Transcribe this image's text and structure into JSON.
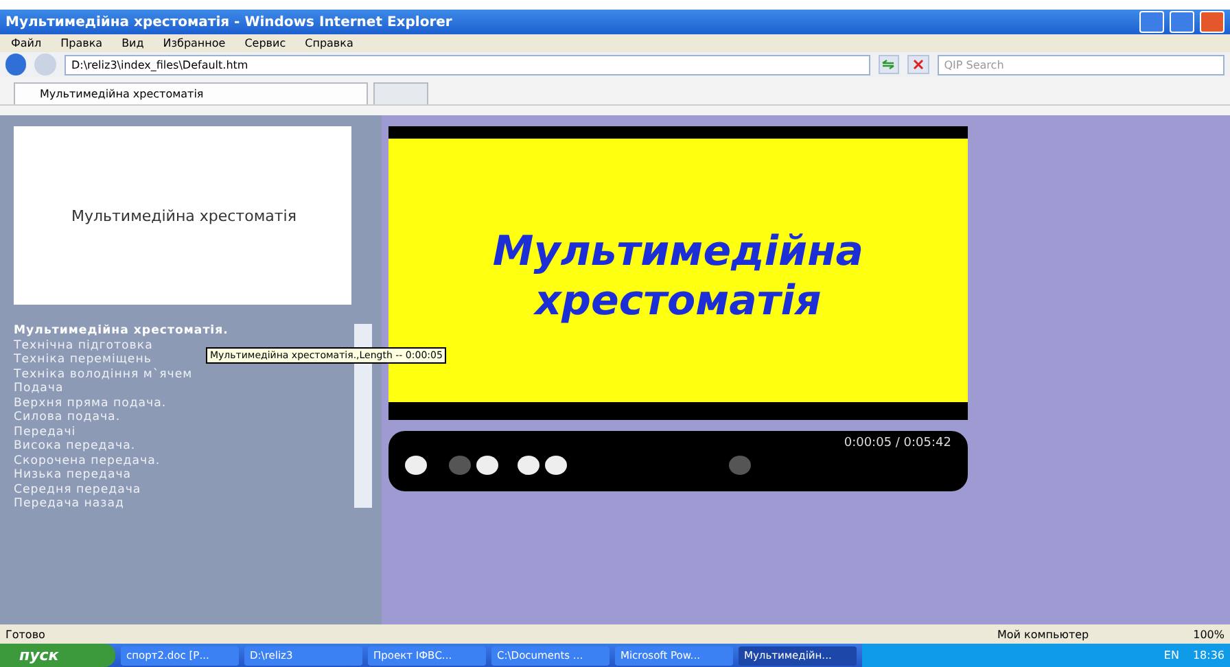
{
  "window": {
    "title": "Мультимедійна хрестоматія - Windows Internet Explorer"
  },
  "menu": [
    "Файл",
    "Правка",
    "Вид",
    "Избранное",
    "Сервис",
    "Справка"
  ],
  "address": {
    "value": "D:\\reliz3\\index_files\\Default.htm"
  },
  "search": {
    "placeholder": "QIP Search"
  },
  "tabs": [
    {
      "label": "Мультимедійна хрестоматія",
      "selected": true
    }
  ],
  "slide_thumbnail": {
    "title": "Мультимедійна хрестоматія"
  },
  "playlist": [
    {
      "label": "Мультимедійна хрестоматія.",
      "selected": true
    },
    {
      "label": "Технічна підготовка",
      "selected": false
    },
    {
      "label": "Техніка переміщень",
      "selected": false
    },
    {
      "label": "Техніка володіння м`ячем",
      "selected": false
    },
    {
      "label": "Подача",
      "selected": false
    },
    {
      "label": "Верхня пряма подача.",
      "selected": false
    },
    {
      "label": "Силова подача.",
      "selected": false
    },
    {
      "label": "Передачі",
      "selected": false
    },
    {
      "label": "Висока передача.",
      "selected": false
    },
    {
      "label": "Скорочена передача.",
      "selected": false
    },
    {
      "label": "Низька передача",
      "selected": false
    },
    {
      "label": "Середня передача",
      "selected": false
    },
    {
      "label": "Передача назад",
      "selected": false
    }
  ],
  "tooltip": "Мультимедійна хрестоматія.,Length -- 0:00:05",
  "video": {
    "title": "Мультимедійна хрестоматія",
    "time": "0:00:05 / 0:05:42"
  },
  "status_bar": {
    "text": "Готово",
    "zone": "Мой компьютер",
    "zoom": "100%"
  },
  "taskbar": {
    "start": "пуск",
    "items": [
      {
        "label": "спорт2.doc [Р...",
        "selected": false
      },
      {
        "label": "D:\\reliz3",
        "selected": false
      },
      {
        "label": "Проект ІФВС...",
        "selected": false
      },
      {
        "label": "C:\\Documents ...",
        "selected": false
      },
      {
        "label": "Microsoft Pow...",
        "selected": false
      },
      {
        "label": "Мультимедійн...",
        "selected": true
      }
    ],
    "lang": "EN",
    "clock": "18:36"
  }
}
